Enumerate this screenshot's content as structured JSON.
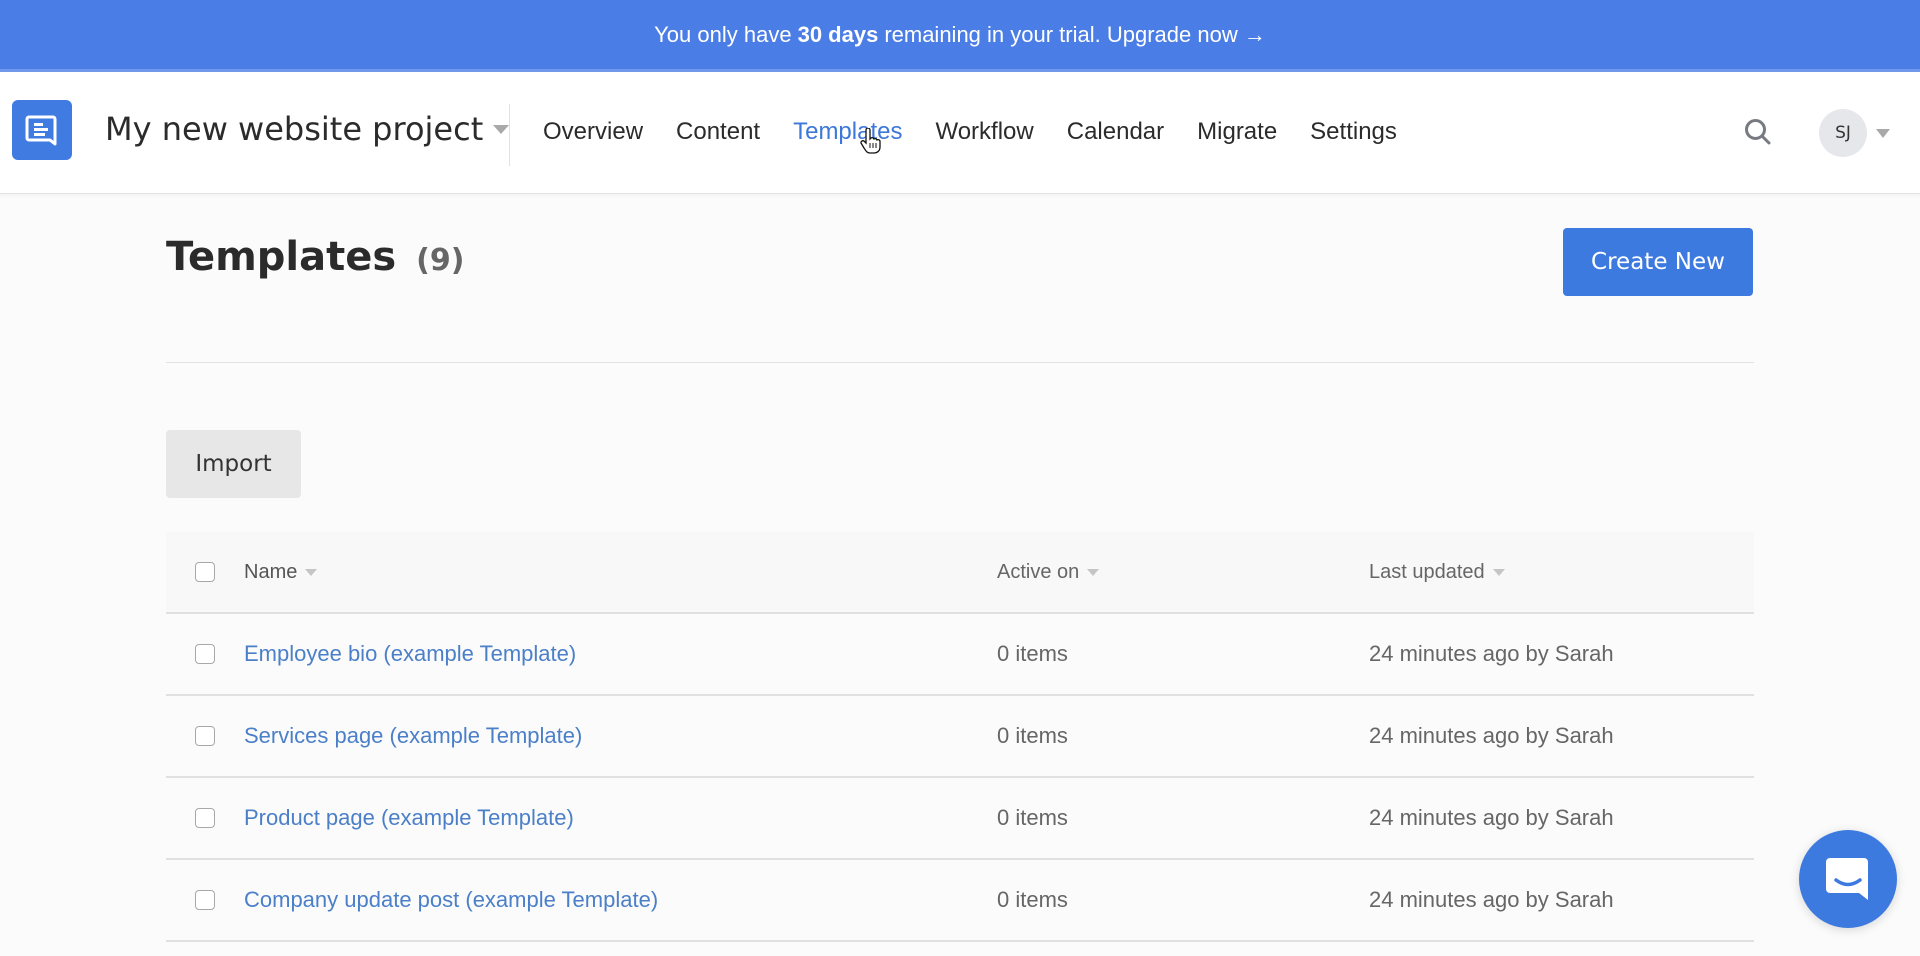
{
  "banner": {
    "prefix": "You only have",
    "days": "30 days",
    "suffix": "remaining in your trial. Upgrade now →"
  },
  "header": {
    "logo_icon": "chat-document-icon",
    "project_name": "My new website project",
    "nav": [
      {
        "label": "Overview",
        "active": false
      },
      {
        "label": "Content",
        "active": false
      },
      {
        "label": "Templates",
        "active": true
      },
      {
        "label": "Workflow",
        "active": false
      },
      {
        "label": "Calendar",
        "active": false
      },
      {
        "label": "Migrate",
        "active": false
      },
      {
        "label": "Settings",
        "active": false
      }
    ],
    "search_icon": "search-icon",
    "avatar_initials": "SJ"
  },
  "page": {
    "title": "Templates",
    "count": "(9)",
    "create_label": "Create New",
    "import_label": "Import"
  },
  "table": {
    "columns": [
      "Name",
      "Active on",
      "Last updated"
    ],
    "rows": [
      {
        "name": "Employee bio (example Template)",
        "active_on": "0 items",
        "updated": "24 minutes ago by Sarah"
      },
      {
        "name": "Services page (example Template)",
        "active_on": "0 items",
        "updated": "24 minutes ago by Sarah"
      },
      {
        "name": "Product page (example Template)",
        "active_on": "0 items",
        "updated": "24 minutes ago by Sarah"
      },
      {
        "name": "Company update post (example Template)",
        "active_on": "0 items",
        "updated": "24 minutes ago by Sarah"
      }
    ]
  },
  "colors": {
    "banner": "#4b7de6",
    "accent": "#3d7ae0",
    "link": "#4b7fc8"
  }
}
